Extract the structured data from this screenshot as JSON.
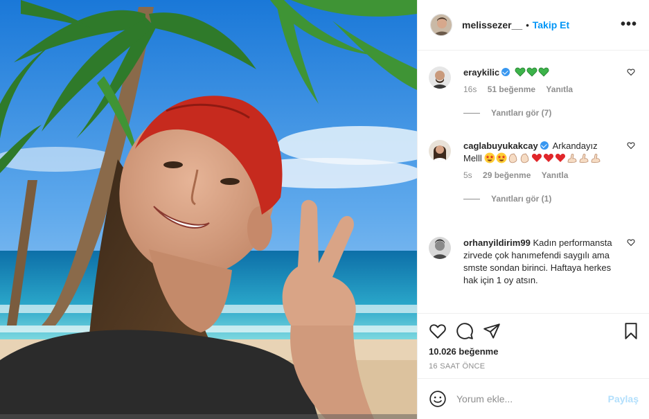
{
  "post": {
    "username": "melissezer__",
    "follow_label": "Takip Et",
    "more_icon": "more-horizontal-icon"
  },
  "comments": [
    {
      "username": "eraykilic",
      "verified": true,
      "text": "",
      "emojis": [
        "green-heart",
        "green-heart",
        "green-heart"
      ],
      "age": "16s",
      "likes": "51 beğenme",
      "reply": "Yanıtla",
      "view_replies": "Yanıtları gör (7)"
    },
    {
      "username": "caglabuyukakcay",
      "verified": true,
      "text": "Arkandayız Melll",
      "emojis": [
        "star-struck",
        "star-struck",
        "clap",
        "clap",
        "red-heart",
        "red-heart",
        "red-heart",
        "flexed-bicep",
        "flexed-bicep",
        "flexed-bicep"
      ],
      "age": "5s",
      "likes": "29 beğenme",
      "reply": "Yanıtla",
      "view_replies": "Yanıtları gör (1)"
    },
    {
      "username": "orhanyildirim99",
      "verified": false,
      "text": "Kadın performansta zirvede çok hanımefendi saygılı ama smste sondan birinci. Haftaya herkes hak için 1 oy atsın.",
      "emojis": []
    }
  ],
  "actions": {
    "icons": [
      "heart-icon",
      "comment-icon",
      "share-icon",
      "bookmark-icon"
    ],
    "likes_count": "10.026 beğenme",
    "time": "16 SAAT ÖNCE"
  },
  "comment_box": {
    "placeholder": "Yorum ekle...",
    "post_label": "Paylaş"
  },
  "colors": {
    "accent": "#0095f6",
    "verified": "#3897f0",
    "muted": "#8e8e8e",
    "post_disabled": "#b2dffc"
  }
}
